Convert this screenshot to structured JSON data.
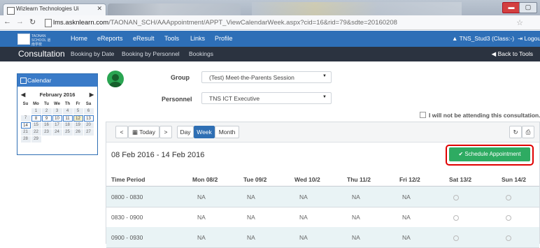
{
  "browser": {
    "tab_title": "Wizlearn Technologies Ui",
    "url_host": "lms.asknlearn.com",
    "url_path": "/TAONAN_SCH/AAAppointment/APPT_ViewCalendarWeek.aspx?cid=16&rid=79&sdte=20160208"
  },
  "app_nav": {
    "logo_text": "TAONAN SCHOOL 道南学校",
    "links": [
      "Home",
      "eReports",
      "eResult",
      "Tools",
      "Links",
      "Profile"
    ],
    "user": "TNS_Stud3 (Class:-)",
    "logout": "Logout"
  },
  "sub_nav": {
    "title": "Consultation",
    "links": [
      "Booking by Date",
      "Booking by Personnel",
      "Bookings"
    ],
    "back": "Back to Tools"
  },
  "calendar_widget": {
    "title": "Calendar",
    "month": "February 2016",
    "day_headers": [
      "Su",
      "Mo",
      "Tu",
      "We",
      "Th",
      "Fr",
      "Sa"
    ],
    "days": [
      "",
      "1",
      "2",
      "3",
      "4",
      "5",
      "6",
      "7",
      "8",
      "9",
      "10",
      "11",
      "12",
      "13",
      "14",
      "15",
      "16",
      "17",
      "18",
      "19",
      "20",
      "21",
      "22",
      "23",
      "24",
      "25",
      "26",
      "27",
      "28",
      "29"
    ]
  },
  "form": {
    "group_label": "Group",
    "group_value": "(Test) Meet-the-Parents Session",
    "personnel_label": "Personnel",
    "personnel_value": "TNS ICT Executive"
  },
  "attend_checkbox": "I will not be attending this consultation.",
  "toolbar": {
    "prev": "<",
    "today": "Today",
    "next": ">",
    "day": "Day",
    "week": "Week",
    "month": "Month",
    "refresh": "↻",
    "print": "⎙"
  },
  "date_range": "08 Feb 2016 - 14 Feb 2016",
  "schedule_button": "✔ Schedule Appointment",
  "table": {
    "headers": [
      "Time Period",
      "Mon 08/2",
      "Tue 09/2",
      "Wed 10/2",
      "Thu 11/2",
      "Fri 12/2",
      "Sat 13/2",
      "Sun 14/2"
    ],
    "rows": [
      {
        "time": "0800 - 0830",
        "cells": [
          "NA",
          "NA",
          "NA",
          "NA",
          "NA"
        ]
      },
      {
        "time": "0830 - 0900",
        "cells": [
          "NA",
          "NA",
          "NA",
          "NA",
          "NA"
        ]
      },
      {
        "time": "0900 - 0930",
        "cells": [
          "NA",
          "NA",
          "NA",
          "NA",
          "NA"
        ]
      }
    ]
  },
  "colors": {
    "nav_blue": "#2e6fb7",
    "dark_bar": "#2b3340",
    "active_blue": "#2f6fb4",
    "green": "#2eab62",
    "highlight_red": "#e00000"
  }
}
